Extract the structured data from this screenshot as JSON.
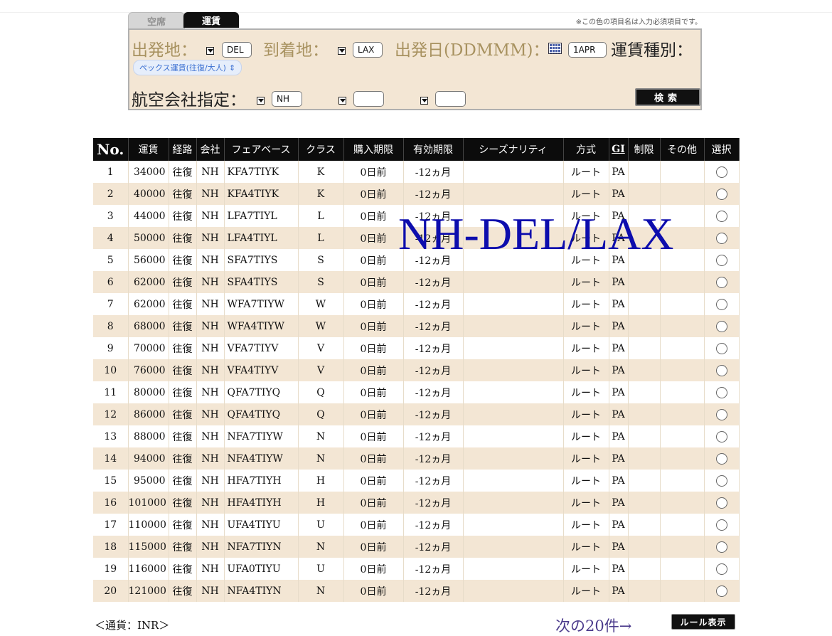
{
  "tabs": [
    {
      "label": "空席",
      "active": false
    },
    {
      "label": "運賃",
      "active": true
    }
  ],
  "required_note": "※この色の項目名は入力必須項目です。",
  "search": {
    "origin_label": "出発地：",
    "origin_value": "DEL",
    "destination_label": "到着地：",
    "destination_value": "LAX",
    "date_label": "出発日(DDMMM)：",
    "date_value": "1APR",
    "fare_type_label": "運賃種別：",
    "fare_type_value": "ペックス運賃(往復/大人)",
    "airline_label": "航空会社指定：",
    "airline_values": [
      "NH",
      "",
      ""
    ],
    "search_button": "検索"
  },
  "table": {
    "headers": [
      "No.",
      "運賃",
      "経路",
      "会社",
      "フェアベース",
      "クラス",
      "購入期限",
      "有効期限",
      "シーズナリティ",
      "方式",
      "GI",
      "制限",
      "その他",
      "選択"
    ],
    "rows": [
      {
        "no": "1",
        "fare": "34000",
        "route": "往復",
        "airline": "NH",
        "basis": "KFA7TIYK",
        "class": "K",
        "purchase": "0日前",
        "validity": "-12ヵ月",
        "season": "",
        "method": "ルート",
        "gi": "PA",
        "restriction": "",
        "other": ""
      },
      {
        "no": "2",
        "fare": "40000",
        "route": "往復",
        "airline": "NH",
        "basis": "KFA4TIYK",
        "class": "K",
        "purchase": "0日前",
        "validity": "-12ヵ月",
        "season": "",
        "method": "ルート",
        "gi": "PA",
        "restriction": "",
        "other": ""
      },
      {
        "no": "3",
        "fare": "44000",
        "route": "往復",
        "airline": "NH",
        "basis": "LFA7TIYL",
        "class": "L",
        "purchase": "0日前",
        "validity": "-12ヵ月",
        "season": "",
        "method": "ルート",
        "gi": "PA",
        "restriction": "",
        "other": ""
      },
      {
        "no": "4",
        "fare": "50000",
        "route": "往復",
        "airline": "NH",
        "basis": "LFA4TIYL",
        "class": "L",
        "purchase": "0日前",
        "validity": "-12ヵ月",
        "season": "",
        "method": "ルート",
        "gi": "PA",
        "restriction": "",
        "other": ""
      },
      {
        "no": "5",
        "fare": "56000",
        "route": "往復",
        "airline": "NH",
        "basis": "SFA7TIYS",
        "class": "S",
        "purchase": "0日前",
        "validity": "-12ヵ月",
        "season": "",
        "method": "ルート",
        "gi": "PA",
        "restriction": "",
        "other": ""
      },
      {
        "no": "6",
        "fare": "62000",
        "route": "往復",
        "airline": "NH",
        "basis": "SFA4TIYS",
        "class": "S",
        "purchase": "0日前",
        "validity": "-12ヵ月",
        "season": "",
        "method": "ルート",
        "gi": "PA",
        "restriction": "",
        "other": ""
      },
      {
        "no": "7",
        "fare": "62000",
        "route": "往復",
        "airline": "NH",
        "basis": "WFA7TIYW",
        "class": "W",
        "purchase": "0日前",
        "validity": "-12ヵ月",
        "season": "",
        "method": "ルート",
        "gi": "PA",
        "restriction": "",
        "other": ""
      },
      {
        "no": "8",
        "fare": "68000",
        "route": "往復",
        "airline": "NH",
        "basis": "WFA4TIYW",
        "class": "W",
        "purchase": "0日前",
        "validity": "-12ヵ月",
        "season": "",
        "method": "ルート",
        "gi": "PA",
        "restriction": "",
        "other": ""
      },
      {
        "no": "9",
        "fare": "70000",
        "route": "往復",
        "airline": "NH",
        "basis": "VFA7TIYV",
        "class": "V",
        "purchase": "0日前",
        "validity": "-12ヵ月",
        "season": "",
        "method": "ルート",
        "gi": "PA",
        "restriction": "",
        "other": ""
      },
      {
        "no": "10",
        "fare": "76000",
        "route": "往復",
        "airline": "NH",
        "basis": "VFA4TIYV",
        "class": "V",
        "purchase": "0日前",
        "validity": "-12ヵ月",
        "season": "",
        "method": "ルート",
        "gi": "PA",
        "restriction": "",
        "other": ""
      },
      {
        "no": "11",
        "fare": "80000",
        "route": "往復",
        "airline": "NH",
        "basis": "QFA7TIYQ",
        "class": "Q",
        "purchase": "0日前",
        "validity": "-12ヵ月",
        "season": "",
        "method": "ルート",
        "gi": "PA",
        "restriction": "",
        "other": ""
      },
      {
        "no": "12",
        "fare": "86000",
        "route": "往復",
        "airline": "NH",
        "basis": "QFA4TIYQ",
        "class": "Q",
        "purchase": "0日前",
        "validity": "-12ヵ月",
        "season": "",
        "method": "ルート",
        "gi": "PA",
        "restriction": "",
        "other": ""
      },
      {
        "no": "13",
        "fare": "88000",
        "route": "往復",
        "airline": "NH",
        "basis": "NFA7TIYW",
        "class": "N",
        "purchase": "0日前",
        "validity": "-12ヵ月",
        "season": "",
        "method": "ルート",
        "gi": "PA",
        "restriction": "",
        "other": ""
      },
      {
        "no": "14",
        "fare": "94000",
        "route": "往復",
        "airline": "NH",
        "basis": "NFA4TIYW",
        "class": "N",
        "purchase": "0日前",
        "validity": "-12ヵ月",
        "season": "",
        "method": "ルート",
        "gi": "PA",
        "restriction": "",
        "other": ""
      },
      {
        "no": "15",
        "fare": "95000",
        "route": "往復",
        "airline": "NH",
        "basis": "HFA7TIYH",
        "class": "H",
        "purchase": "0日前",
        "validity": "-12ヵ月",
        "season": "",
        "method": "ルート",
        "gi": "PA",
        "restriction": "",
        "other": ""
      },
      {
        "no": "16",
        "fare": "101000",
        "route": "往復",
        "airline": "NH",
        "basis": "HFA4TIYH",
        "class": "H",
        "purchase": "0日前",
        "validity": "-12ヵ月",
        "season": "",
        "method": "ルート",
        "gi": "PA",
        "restriction": "",
        "other": ""
      },
      {
        "no": "17",
        "fare": "110000",
        "route": "往復",
        "airline": "NH",
        "basis": "UFA4TIYU",
        "class": "U",
        "purchase": "0日前",
        "validity": "-12ヵ月",
        "season": "",
        "method": "ルート",
        "gi": "PA",
        "restriction": "",
        "other": ""
      },
      {
        "no": "18",
        "fare": "115000",
        "route": "往復",
        "airline": "NH",
        "basis": "NFA7TIYN",
        "class": "N",
        "purchase": "0日前",
        "validity": "-12ヵ月",
        "season": "",
        "method": "ルート",
        "gi": "PA",
        "restriction": "",
        "other": ""
      },
      {
        "no": "19",
        "fare": "116000",
        "route": "往復",
        "airline": "NH",
        "basis": "UFA0TIYU",
        "class": "U",
        "purchase": "0日前",
        "validity": "-12ヵ月",
        "season": "",
        "method": "ルート",
        "gi": "PA",
        "restriction": "",
        "other": ""
      },
      {
        "no": "20",
        "fare": "121000",
        "route": "往復",
        "airline": "NH",
        "basis": "NFA4TIYN",
        "class": "N",
        "purchase": "0日前",
        "validity": "-12ヵ月",
        "season": "",
        "method": "ルート",
        "gi": "PA",
        "restriction": "",
        "other": ""
      }
    ]
  },
  "overlay_text": "NH-DEL/LAX",
  "footer": {
    "currency": "＜通貨：INR＞",
    "next_link": "次の20件→",
    "rule_button": "ルール表示"
  }
}
